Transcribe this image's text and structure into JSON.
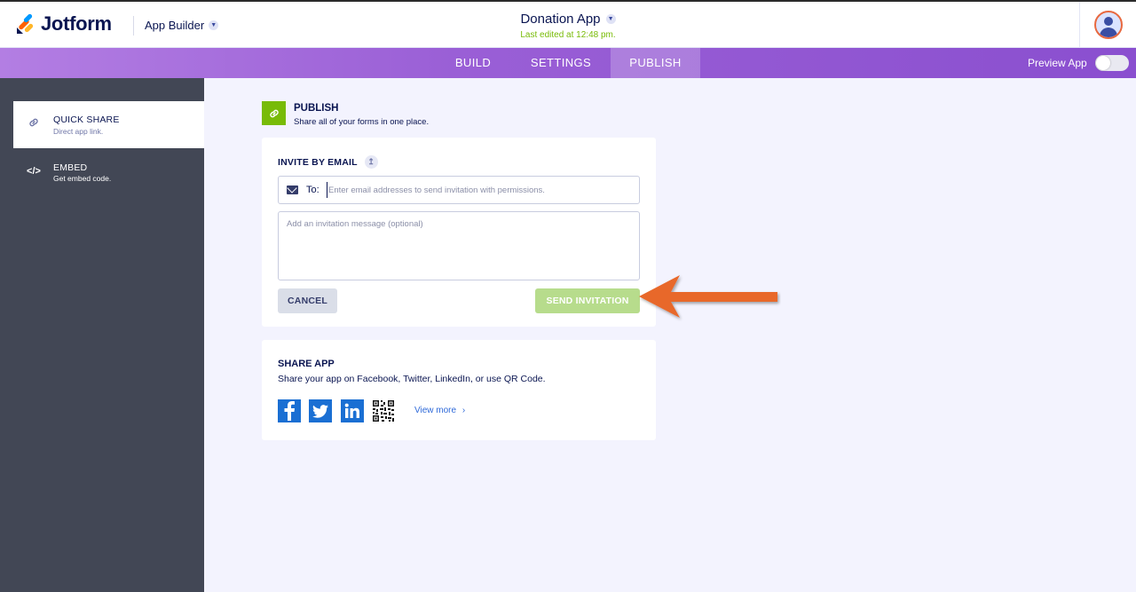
{
  "header": {
    "logo_text": "Jotform",
    "app_builder_label": "App Builder",
    "app_title": "Donation App",
    "last_edited": "Last edited at 12:48 pm."
  },
  "nav": {
    "tabs": [
      "BUILD",
      "SETTINGS",
      "PUBLISH"
    ],
    "active_tab": "PUBLISH",
    "preview_label": "Preview App",
    "preview_on": false
  },
  "sidebar": {
    "items": [
      {
        "title": "QUICK SHARE",
        "subtitle": "Direct app link.",
        "icon": "link-icon",
        "active": true
      },
      {
        "title": "EMBED",
        "subtitle": "Get embed code.",
        "icon": "code-icon",
        "active": false
      }
    ]
  },
  "publish": {
    "title": "PUBLISH",
    "subtitle": "Share all of your forms in one place."
  },
  "invite": {
    "title": "INVITE BY EMAIL",
    "to_label": "To:",
    "to_placeholder": "Enter email addresses to send invitation with permissions.",
    "message_placeholder": "Add an invitation message (optional)",
    "cancel_label": "CANCEL",
    "send_label": "SEND INVITATION"
  },
  "share": {
    "title": "SHARE APP",
    "subtitle": "Share your app on Facebook, Twitter, LinkedIn, or use QR Code.",
    "networks": [
      "facebook-icon",
      "twitter-icon",
      "linkedin-icon",
      "qr-code-icon"
    ],
    "view_more_label": "View more",
    "view_more_chevron": "›"
  },
  "colors": {
    "accent_green": "#78bb07",
    "nav_purple": "#9a5fd6",
    "sidebar_dark": "#424755",
    "arrow_orange": "#e8672a",
    "link_blue": "#2f6ad9"
  }
}
